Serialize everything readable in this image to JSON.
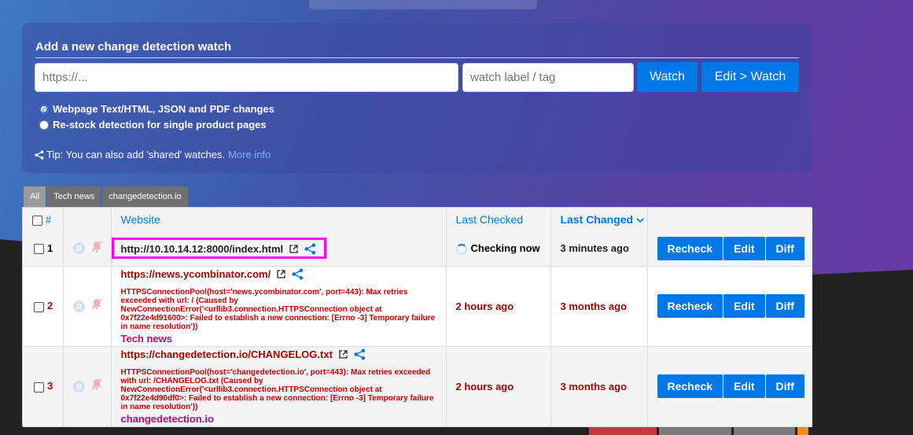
{
  "add_form": {
    "title": "Add a new change detection watch",
    "url_placeholder": "https://...",
    "tag_placeholder": "watch label / tag",
    "watch_label": "Watch",
    "edit_watch_label": "Edit > Watch",
    "radio_options": [
      {
        "label": "Webpage Text/HTML, JSON and PDF changes",
        "checked": true
      },
      {
        "label": "Re-stock detection for single product pages",
        "checked": false
      }
    ],
    "tip_text": "Tip: You can also add 'shared' watches.",
    "tip_link": "More info"
  },
  "tag_tabs": [
    "All",
    "Tech news",
    "changedetection.io"
  ],
  "table": {
    "headers": {
      "num": "#",
      "website": "Website",
      "last_checked": "Last Checked",
      "last_changed": "Last Changed"
    },
    "rows": [
      {
        "num": "1",
        "url": "http://10.10.14.12:8000/index.html",
        "error": "",
        "tag": "",
        "last_checked": "Checking now",
        "last_changed": "3 minutes ago"
      },
      {
        "num": "2",
        "url": "https://news.ycombinator.com/",
        "error": "HTTPSConnectionPool(host='news.ycombinator.com', port=443): Max retries exceeded with url: / (Caused by NewConnectionError('<urllib3.connection.HTTPSConnection object at 0x7f22e4d91600>: Failed to establish a new connection: [Errno -3] Temporary failure in name resolution'))",
        "tag": "Tech news",
        "last_checked": "2 hours ago",
        "last_changed": "3 months ago"
      },
      {
        "num": "3",
        "url": "https://changedetection.io/CHANGELOG.txt",
        "error": "HTTPSConnectionPool(host='changedetection.io', port=443): Max retries exceeded with url: /CHANGELOG.txt (Caused by NewConnectionError('<urllib3.connection.HTTPSConnection object at 0x7f22e4d90df0>: Failed to establish a new connection: [Errno -3] Temporary failure in name resolution'))",
        "tag": "changedetection.io",
        "last_checked": "2 hours ago",
        "last_changed": "3 months ago"
      }
    ],
    "actions": {
      "recheck": "Recheck",
      "edit": "Edit",
      "diff": "Diff"
    }
  },
  "colors": {
    "accent": "#0078e7",
    "error": "#cc0000",
    "tag": "#d6006e",
    "highlight": "#ff00ff"
  }
}
